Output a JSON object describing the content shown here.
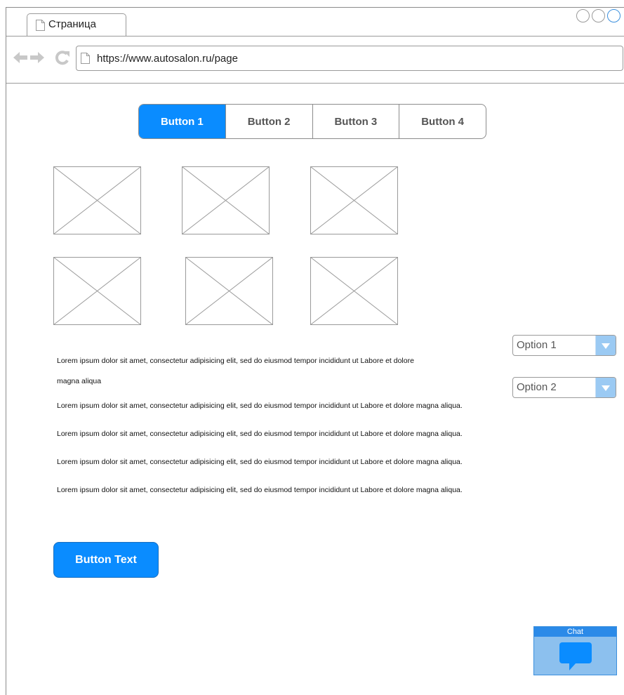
{
  "browser": {
    "tab_title": "Страница",
    "url": "https://www.autosalon.ru/page"
  },
  "segmented": {
    "buttons": [
      "Button 1",
      "Button 2",
      "Button 3",
      "Button 4"
    ],
    "selected_index": 0
  },
  "paragraphs": [
    "Lorem ipsum dolor sit amet, consectetur adipisicing elit, sed do eiusmod tempor incididunt ut Labore et dolore",
    "magna aliqua",
    "Lorem ipsum dolor sit amet, consectetur adipisicing elit, sed do eiusmod tempor incididunt ut Labore et dolore magna aliqua.",
    "Lorem ipsum dolor sit amet, consectetur adipisicing elit, sed do eiusmod tempor incididunt ut Labore et dolore magna aliqua.",
    "Lorem ipsum dolor sit amet, consectetur adipisicing elit, sed do eiusmod tempor incididunt ut Labore et dolore magna aliqua.",
    "Lorem ipsum dolor sit amet, consectetur adipisicing elit, sed do eiusmod tempor incididunt ut Labore et dolore magna aliqua."
  ],
  "selects": [
    {
      "value": "Option 1"
    },
    {
      "value": "Option 2"
    }
  ],
  "cta_label": "Button Text",
  "chat_label": "Chat",
  "colors": {
    "accent": "#0a8cff",
    "chat_header": "#2b8ae8",
    "chat_body": "#8cc0ee"
  }
}
